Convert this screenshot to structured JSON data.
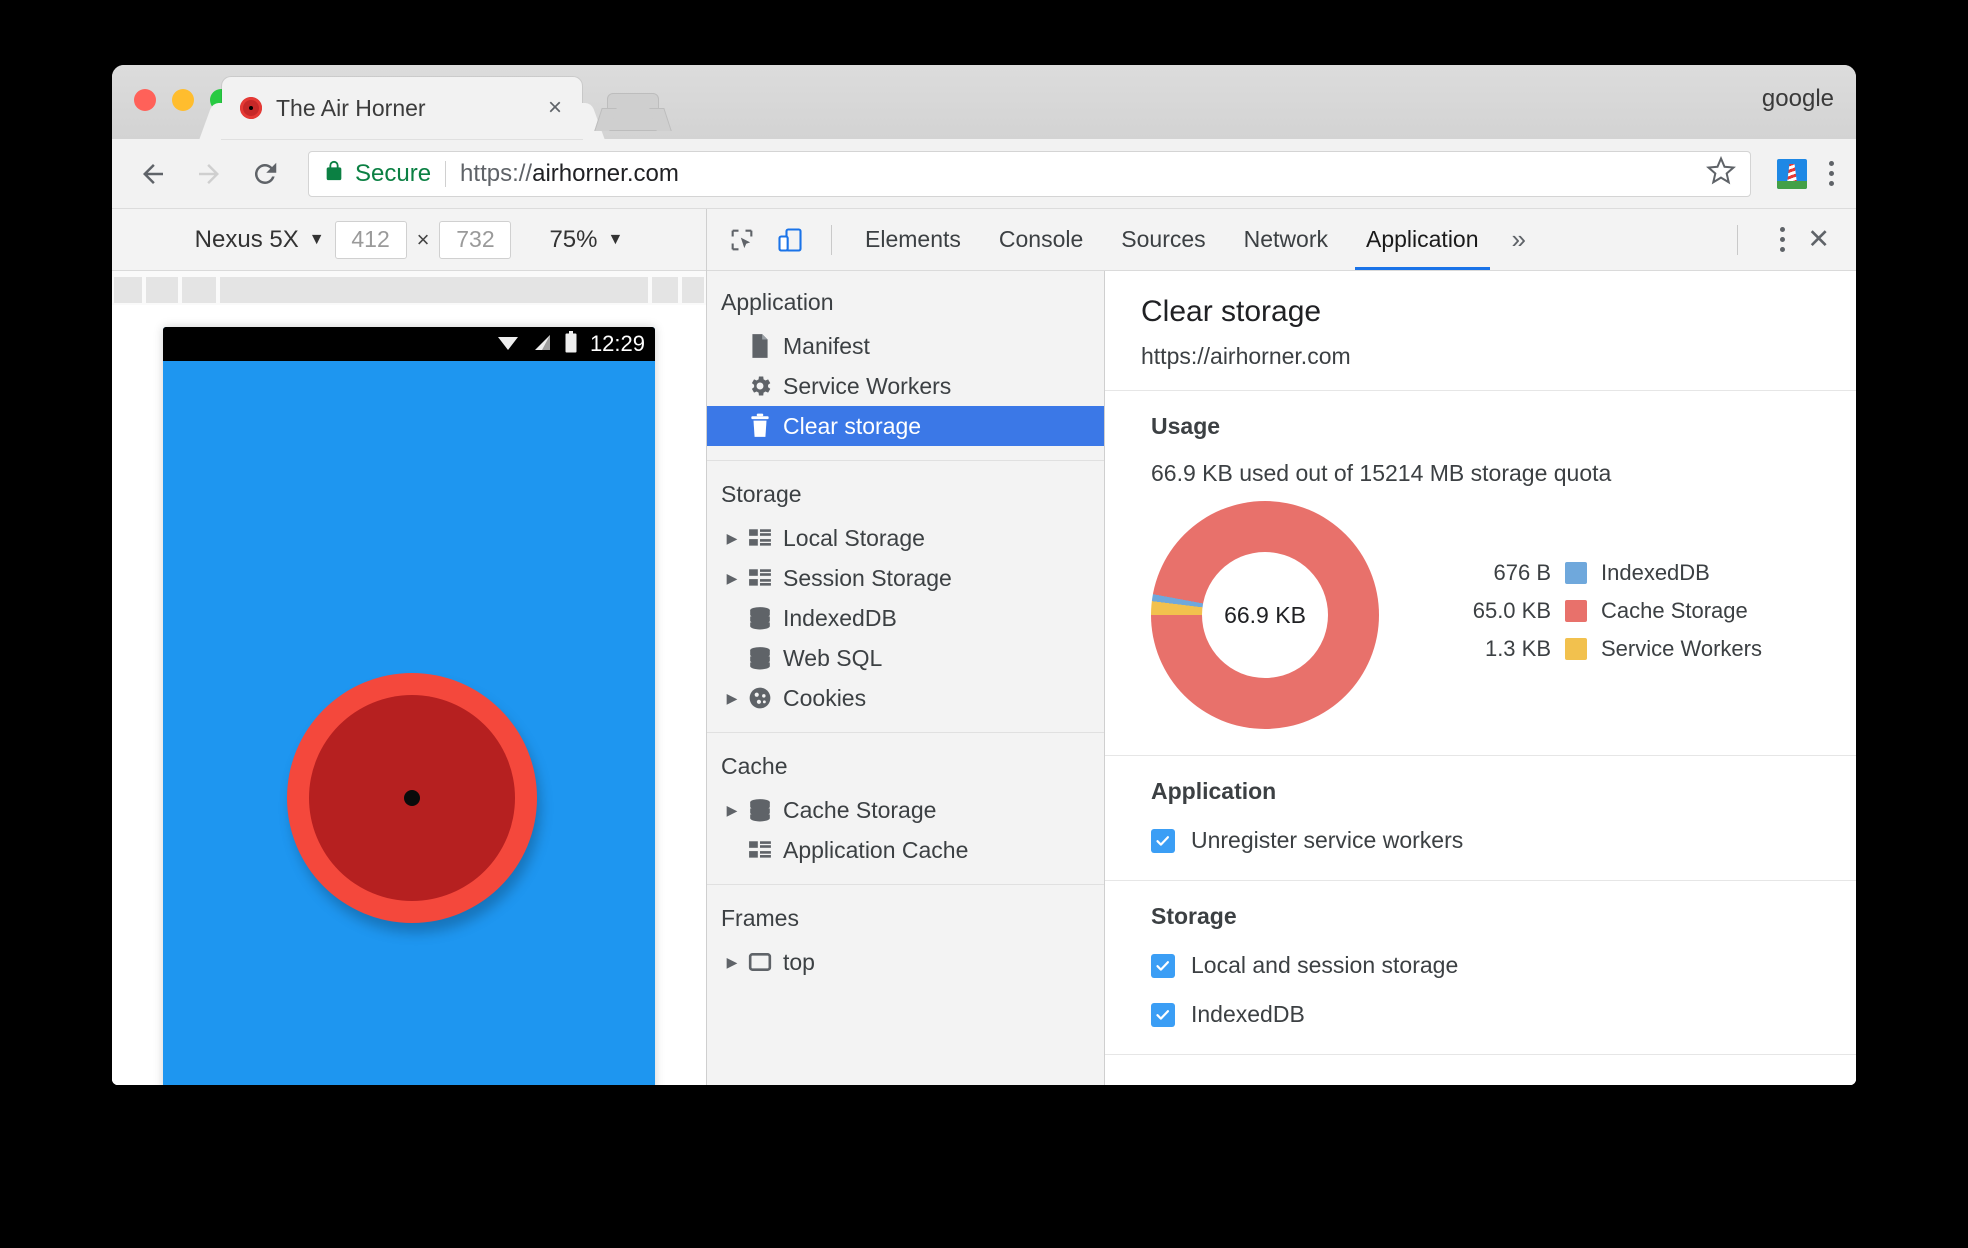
{
  "browser": {
    "profile_name": "google",
    "tab": {
      "title": "The Air Horner",
      "close_label": "×",
      "favicon": "air-horner-favicon"
    },
    "new_tab_label": "",
    "back_label": "Back",
    "forward_label": "Forward",
    "reload_label": "Reload",
    "omnibox": {
      "secure_label": "Secure",
      "url_scheme": "https://",
      "url_host": "airhorner.com",
      "url_full": "https://airhorner.com"
    },
    "bookmark_label": "Bookmark this page",
    "extension_label": "Lighthouse",
    "menu_label": "Customize and control Google Chrome"
  },
  "device_toolbar": {
    "device": "Nexus 5X",
    "width": "412",
    "height": "732",
    "multiply": "×",
    "zoom": "75%",
    "caret": "▼"
  },
  "device_screen": {
    "time": "12:29",
    "wifi_icon": "wifi-icon",
    "cellular_icon": "cellular-signal-icon",
    "battery_icon": "battery-icon",
    "page_background": "#1e96f0",
    "horn_outer_color": "#f4483c",
    "horn_inner_color": "#b62020"
  },
  "devtools": {
    "inspect_icon": "inspect-element-icon",
    "device_toggle_icon": "toggle-device-toolbar-icon",
    "tabs": [
      {
        "label": "Elements",
        "active": false
      },
      {
        "label": "Console",
        "active": false
      },
      {
        "label": "Sources",
        "active": false
      },
      {
        "label": "Network",
        "active": false
      },
      {
        "label": "Application",
        "active": true
      }
    ],
    "more_tabs": "»",
    "menu_label": "Customize and control DevTools",
    "close_label": "✕",
    "sidebar": [
      {
        "header": "Application",
        "items": [
          {
            "label": "Manifest",
            "icon": "manifest-document-icon",
            "twisty": false,
            "selected": false
          },
          {
            "label": "Service Workers",
            "icon": "gear-icon",
            "twisty": false,
            "selected": false
          },
          {
            "label": "Clear storage",
            "icon": "trash-icon",
            "twisty": false,
            "selected": true
          }
        ]
      },
      {
        "header": "Storage",
        "items": [
          {
            "label": "Local Storage",
            "icon": "table-icon",
            "twisty": true,
            "selected": false
          },
          {
            "label": "Session Storage",
            "icon": "table-icon",
            "twisty": true,
            "selected": false
          },
          {
            "label": "IndexedDB",
            "icon": "database-icon",
            "twisty": false,
            "selected": false
          },
          {
            "label": "Web SQL",
            "icon": "database-icon",
            "twisty": false,
            "selected": false
          },
          {
            "label": "Cookies",
            "icon": "cookie-icon",
            "twisty": true,
            "selected": false
          }
        ]
      },
      {
        "header": "Cache",
        "items": [
          {
            "label": "Cache Storage",
            "icon": "database-icon",
            "twisty": true,
            "selected": false
          },
          {
            "label": "Application Cache",
            "icon": "table-icon",
            "twisty": false,
            "selected": false
          }
        ]
      },
      {
        "header": "Frames",
        "items": [
          {
            "label": "top",
            "icon": "frame-icon",
            "twisty": true,
            "selected": false
          }
        ]
      }
    ],
    "panel": {
      "title": "Clear storage",
      "origin": "https://airhorner.com",
      "usage": {
        "section_title": "Usage",
        "summary": "66.9 KB used out of 15214 MB storage quota",
        "total": "66.9 KB"
      },
      "application": {
        "section_title": "Application",
        "checkboxes": [
          {
            "label": "Unregister service workers",
            "checked": true
          }
        ]
      },
      "storage": {
        "section_title": "Storage",
        "checkboxes": [
          {
            "label": "Local and session storage",
            "checked": true
          },
          {
            "label": "IndexedDB",
            "checked": true
          }
        ]
      }
    }
  },
  "chart_data": {
    "type": "pie",
    "title": "Usage",
    "center_label": "66.9 KB",
    "legend_position": "right",
    "categories": [
      "IndexedDB",
      "Cache Storage",
      "Service Workers"
    ],
    "value_labels": [
      "676 B",
      "65.0 KB",
      "1.3 KB"
    ],
    "values_bytes": [
      676,
      66560,
      1331
    ],
    "percentages": [
      1.0,
      97.1,
      1.9
    ],
    "colors": [
      "#6fa8dc",
      "#e8716b",
      "#f2c14e"
    ],
    "total_label": "66.9 KB",
    "quota_label": "15214 MB"
  }
}
